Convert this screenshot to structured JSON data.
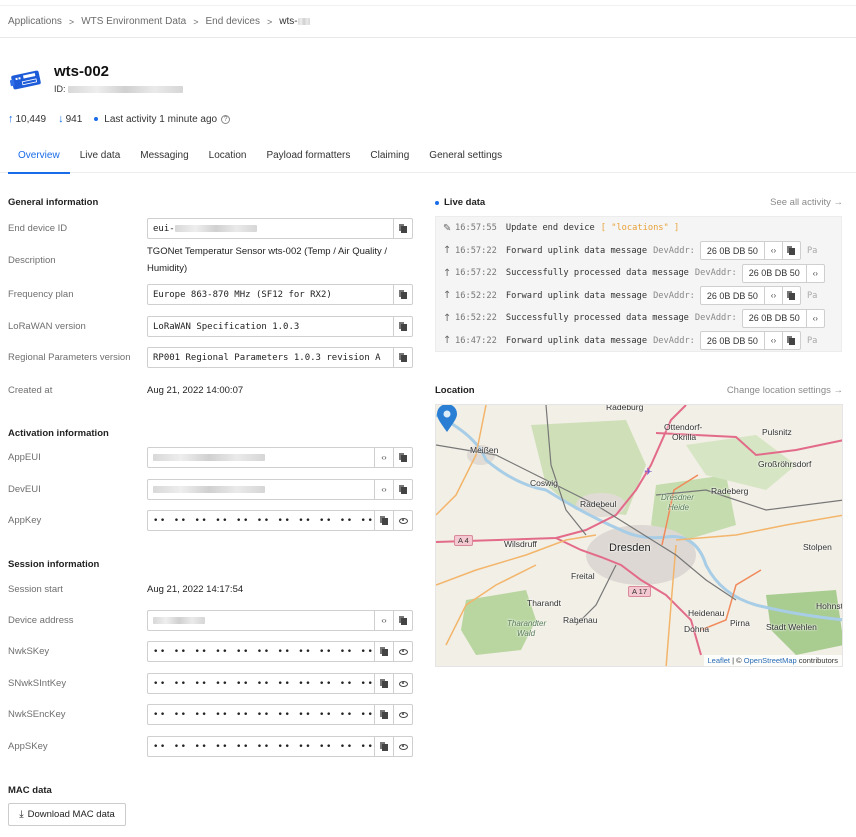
{
  "breadcrumb": [
    {
      "label": "Applications"
    },
    {
      "label": "WTS Environment Data"
    },
    {
      "label": "End devices"
    },
    {
      "label": "wts-"
    }
  ],
  "device": {
    "name": "wts-002",
    "id_label": "ID:",
    "uplink_count": "10,449",
    "downlink_count": "941",
    "last_activity": "Last activity 1 minute ago"
  },
  "tabs": [
    {
      "label": "Overview",
      "active": true
    },
    {
      "label": "Live data"
    },
    {
      "label": "Messaging"
    },
    {
      "label": "Location"
    },
    {
      "label": "Payload formatters"
    },
    {
      "label": "Claiming"
    },
    {
      "label": "General settings"
    }
  ],
  "general": {
    "title": "General information",
    "end_device_id_label": "End device ID",
    "end_device_id_prefix": "eui-",
    "description_label": "Description",
    "description": "TGONet Temperatur Sensor wts-002 (Temp / Air Quality / Humidity)",
    "frequency_plan_label": "Frequency plan",
    "frequency_plan": "Europe 863-870 MHz (SF12 for RX2)",
    "lorawan_version_label": "LoRaWAN version",
    "lorawan_version": "LoRaWAN Specification 1.0.3",
    "regional_params_label": "Regional Parameters version",
    "regional_params": "RP001 Regional Parameters 1.0.3 revision A",
    "created_at_label": "Created at",
    "created_at": "Aug 21, 2022 14:00:07"
  },
  "activation": {
    "title": "Activation information",
    "appeui_label": "AppEUI",
    "deveui_label": "DevEUI",
    "appkey_label": "AppKey",
    "masked": "•• •• •• •• •• •• •• •• •• •• •• •• •• •• •• ••"
  },
  "session": {
    "title": "Session information",
    "session_start_label": "Session start",
    "session_start": "Aug 21, 2022 14:17:54",
    "device_address_label": "Device address",
    "nwkskey_label": "NwkSKey",
    "snwksintkey_label": "SNwkSIntKey",
    "nwksenckey_label": "NwkSEncKey",
    "appskey_label": "AppSKey",
    "masked": "•• •• •• •• •• •• •• •• •• •• •• •• •• •• •• ••"
  },
  "mac": {
    "title": "MAC data",
    "download_label": "Download MAC data"
  },
  "live": {
    "title": "Live data",
    "see_all": "See all activity →",
    "devaddr_key": "DevAddr:",
    "pa": "Pa",
    "rows": [
      {
        "icon": "edit",
        "time": "16:57:55",
        "message": "Update end device",
        "fields": "[ \"locations\" ]"
      },
      {
        "icon": "uplink",
        "time": "16:57:22",
        "message": "Forward uplink data message",
        "devaddr": "26 0B DB 50"
      },
      {
        "icon": "uplink",
        "time": "16:57:22",
        "message": "Successfully processed data message",
        "devaddr": "26 0B DB 50"
      },
      {
        "icon": "uplink",
        "time": "16:52:22",
        "message": "Forward uplink data message",
        "devaddr": "26 0B DB 50"
      },
      {
        "icon": "uplink",
        "time": "16:52:22",
        "message": "Successfully processed data message",
        "devaddr": "26 0B DB 50"
      },
      {
        "icon": "uplink",
        "time": "16:47:22",
        "message": "Forward uplink data message",
        "devaddr": "26 0B DB 50"
      }
    ]
  },
  "location": {
    "title": "Location",
    "change_link": "Change location settings →",
    "map_labels": {
      "top": "Radeburg",
      "meissen": "Meißen",
      "coswig": "Coswig",
      "radebeul": "Radebeul",
      "ottendorf1": "Ottendorf-",
      "ottendorf2": "Okrilla",
      "pulsnitz": "Pulsnitz",
      "grossrohrsdorf": "Großröhrsdorf",
      "radeberg": "Radeberg",
      "heide1": "Dresdner",
      "heide2": "Heide",
      "dresden": "Dresden",
      "wilsdruff": "Wilsdruff",
      "stolpen": "Stolpen",
      "freital": "Freital",
      "tharandt": "Tharandt",
      "rabenau": "Rabenau",
      "wald1": "Tharandter",
      "wald2": "Wald",
      "heidenau": "Heidenau",
      "dohna": "Dohna",
      "pirna": "Pirna",
      "wehlen": "Stadt Wehlen",
      "hohnstein": "Hohnste",
      "a4": "A 4",
      "a17": "A 17"
    },
    "attribution_leaflet": "Leaflet",
    "attribution_sep": " | © ",
    "attribution_osm": "OpenStreetMap",
    "attribution_tail": " contributors"
  }
}
